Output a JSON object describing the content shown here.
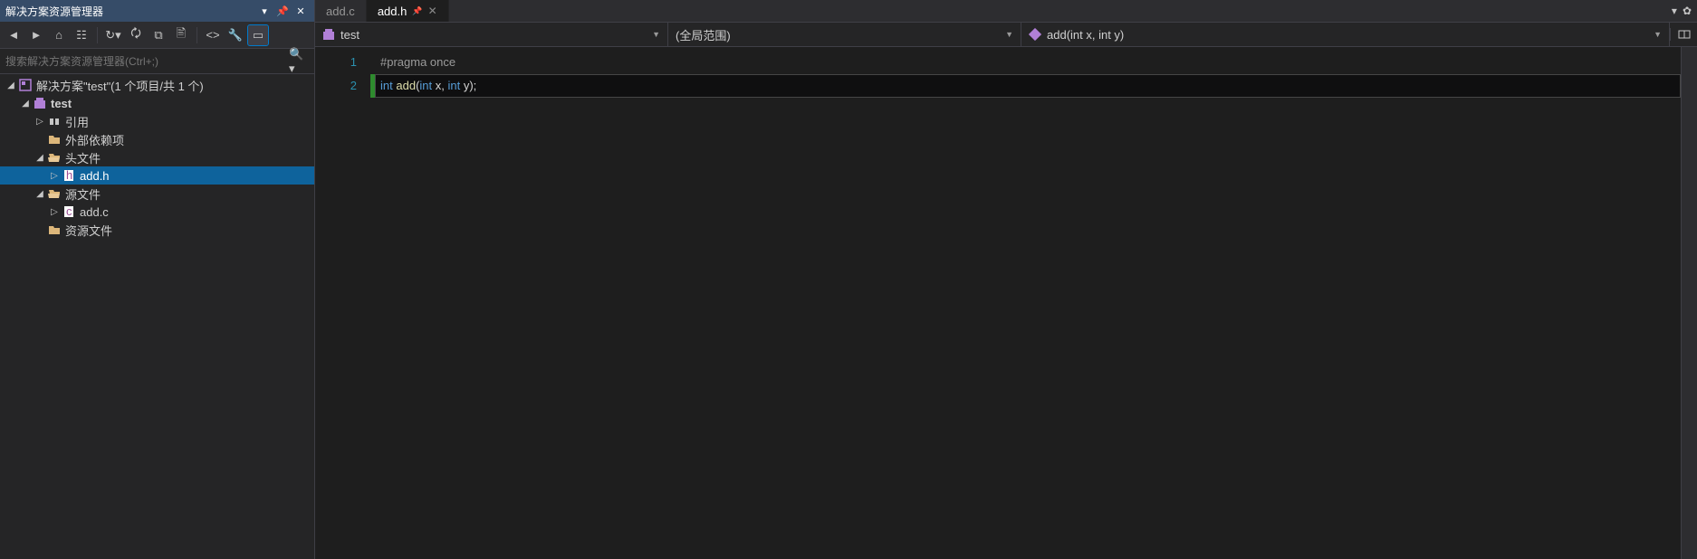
{
  "solution_explorer": {
    "title": "解决方案资源管理器",
    "search_placeholder": "搜索解决方案资源管理器(Ctrl+;)",
    "tree": {
      "solution": {
        "label": "解决方案\"test\"(1 个项目/共 1 个)",
        "icon": "solution-icon"
      },
      "project": {
        "label": "test",
        "icon": "project-icon"
      },
      "refs": {
        "label": "引用",
        "icon": "refs-icon"
      },
      "extdeps": {
        "label": "外部依赖项",
        "icon": "folder-icon"
      },
      "headers": {
        "label": "头文件",
        "icon": "folder-open-icon"
      },
      "addh": {
        "label": "add.h",
        "icon": "h-file-icon"
      },
      "sources": {
        "label": "源文件",
        "icon": "folder-open-icon"
      },
      "addc": {
        "label": "add.c",
        "icon": "c-file-icon"
      },
      "resources": {
        "label": "资源文件",
        "icon": "folder-icon"
      }
    }
  },
  "tabs": [
    {
      "label": "add.c",
      "active": false
    },
    {
      "label": "add.h",
      "active": true
    }
  ],
  "navbar": {
    "project": "test",
    "scope": "(全局范围)",
    "member": "add(int x, int y)"
  },
  "code": {
    "lines": [
      {
        "num": "1",
        "tokens": [
          {
            "t": "#pragma once",
            "c": "tok-pre"
          }
        ],
        "hl": false,
        "bar": ""
      },
      {
        "num": "2",
        "tokens": [
          {
            "t": "int",
            "c": "tok-kw"
          },
          {
            "t": " ",
            "c": "tok-p"
          },
          {
            "t": "add",
            "c": "tok-fn"
          },
          {
            "t": "(",
            "c": "tok-p"
          },
          {
            "t": "int",
            "c": "tok-kw"
          },
          {
            "t": " x, ",
            "c": "tok-p"
          },
          {
            "t": "int",
            "c": "tok-kw"
          },
          {
            "t": " y);",
            "c": "tok-p"
          }
        ],
        "hl": true,
        "bar": "g"
      }
    ]
  }
}
